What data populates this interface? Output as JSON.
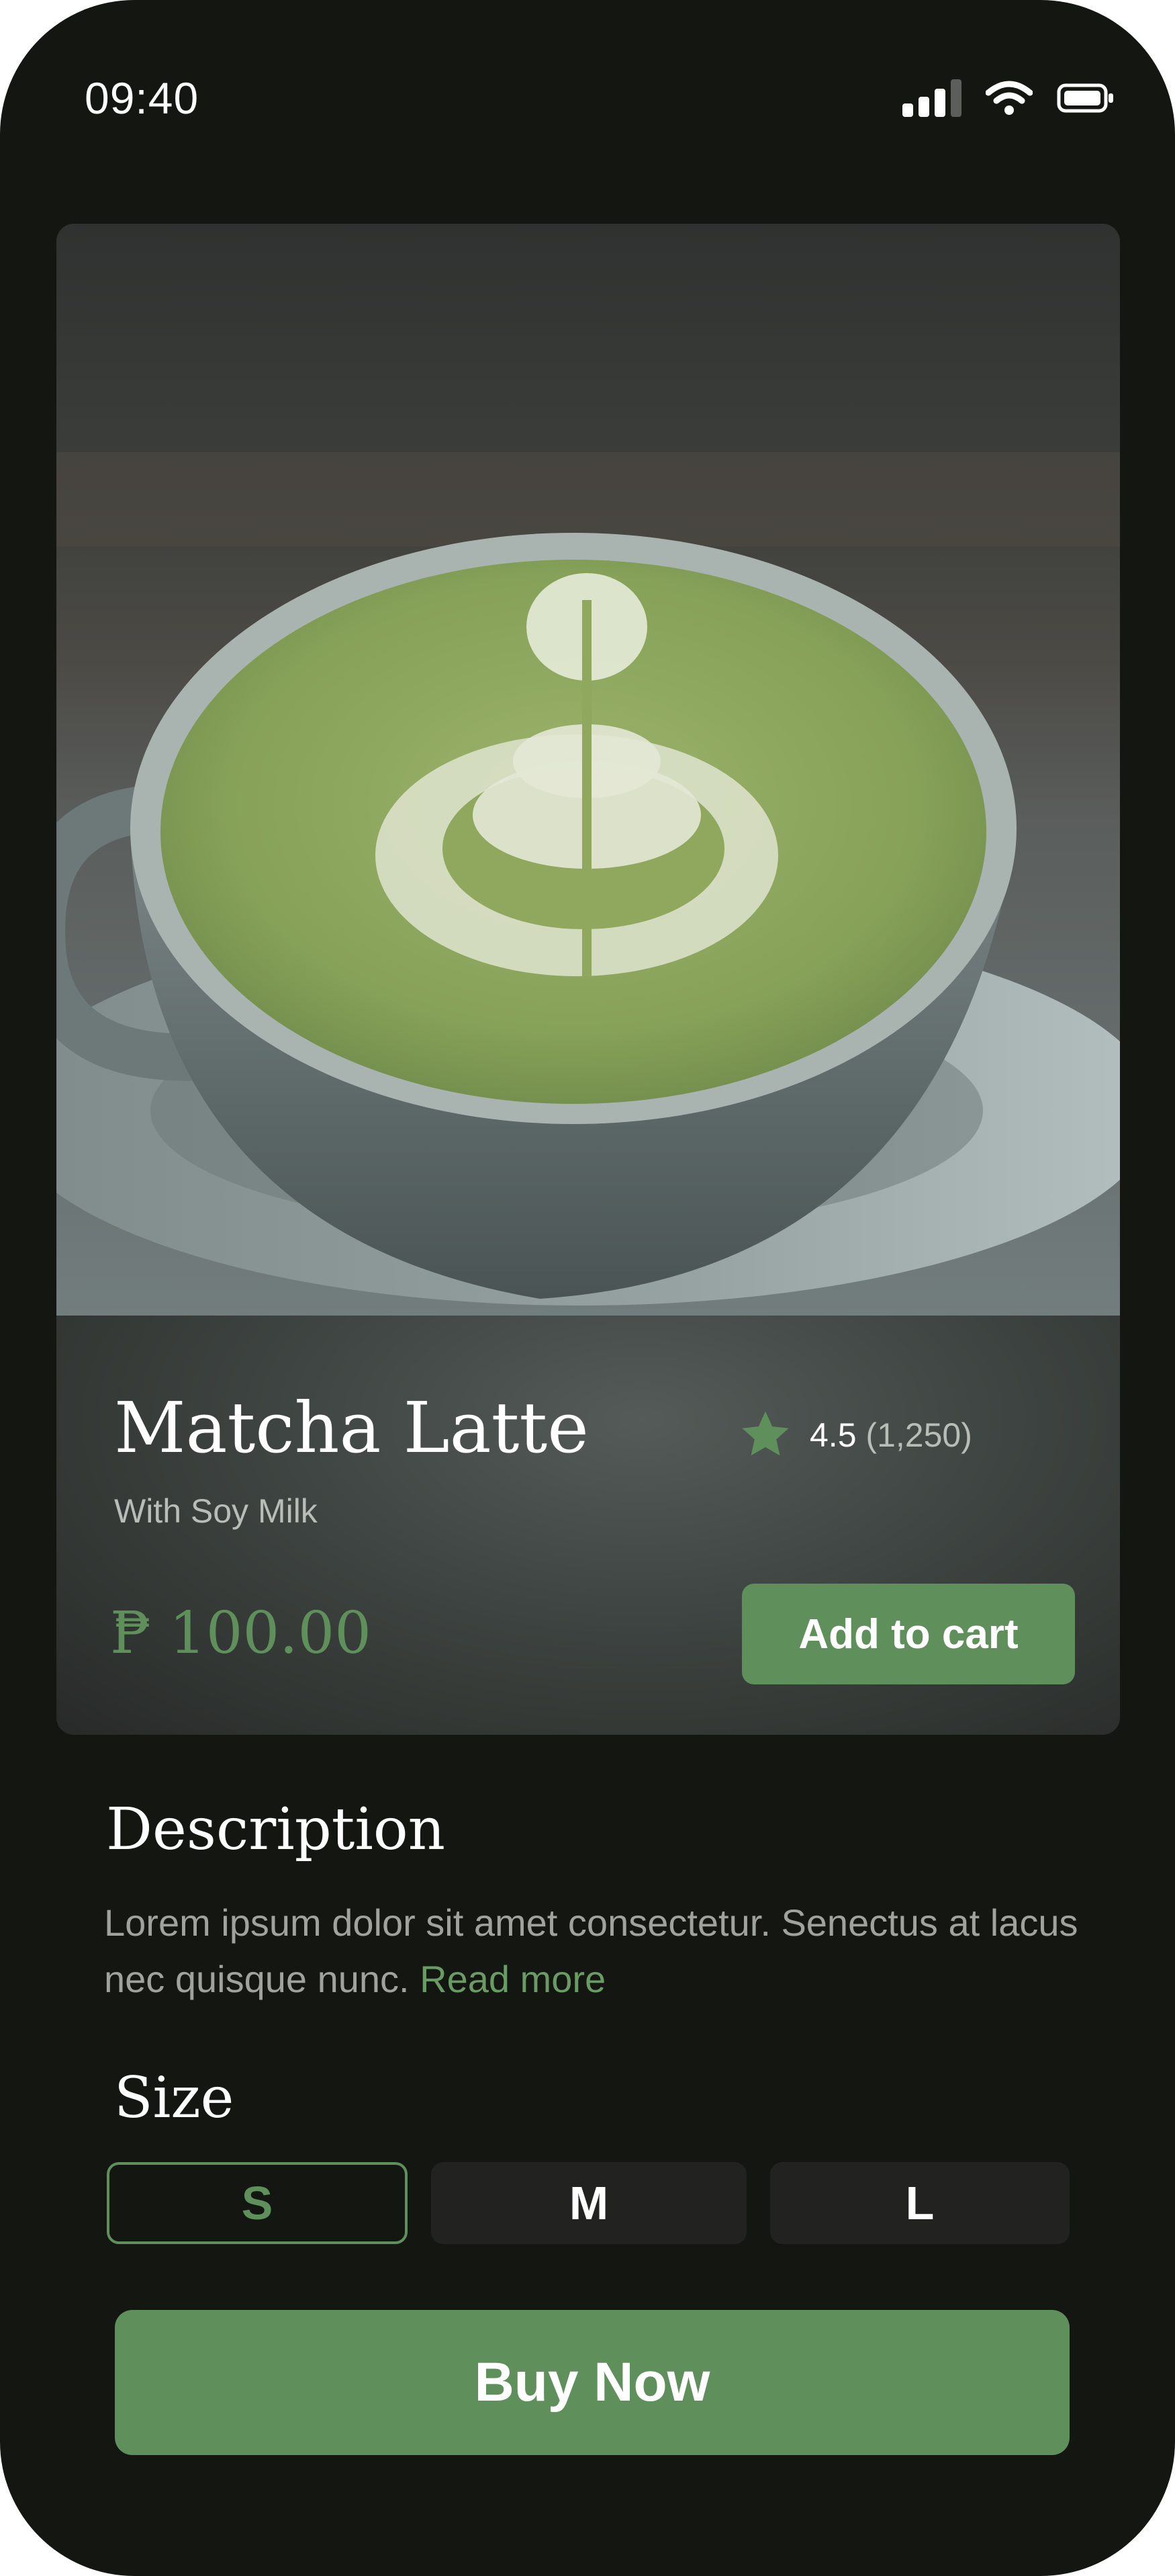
{
  "status_bar": {
    "time": "09:40",
    "icons": [
      "cellular-signal-icon",
      "wifi-icon",
      "battery-icon"
    ]
  },
  "product": {
    "name": "Matcha Latte",
    "subtitle": "With Soy Milk",
    "rating": "4.5",
    "review_count": "(1,250)",
    "price": "₱ 100.00",
    "image": "matcha-latte-photo",
    "add_to_cart_label": "Add to cart"
  },
  "description": {
    "title": "Description",
    "text": "Lorem ipsum dolor sit amet consectetur. Senectus at lacus nec quisque nunc. ",
    "read_more": "Read more"
  },
  "size": {
    "title": "Size",
    "options": [
      {
        "label": "S",
        "selected": true
      },
      {
        "label": "M",
        "selected": false
      },
      {
        "label": "L",
        "selected": false
      }
    ]
  },
  "buy_now_label": "Buy Now",
  "colors": {
    "background": "#131611",
    "accent": "#5f8f5b",
    "muted_text": "#9fa39e",
    "chip_background": "#222321"
  }
}
